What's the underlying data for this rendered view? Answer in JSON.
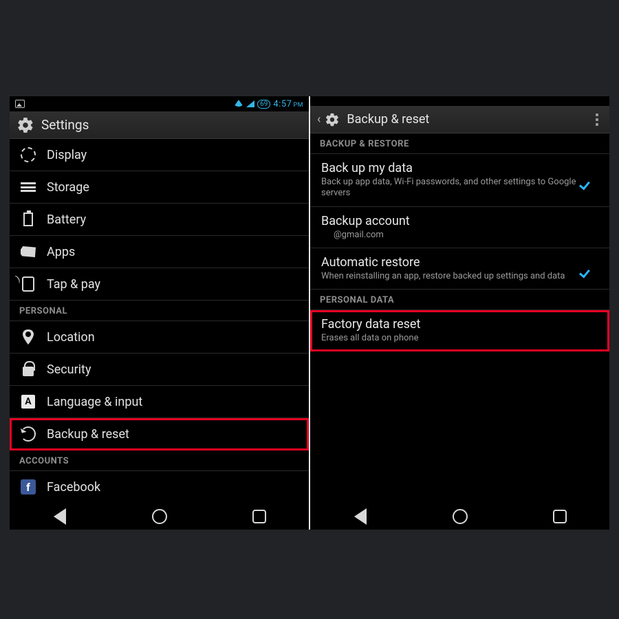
{
  "status": {
    "time": "4:57",
    "period": "PM",
    "battery": "69"
  },
  "left": {
    "title": "Settings",
    "items": [
      {
        "label": "Display",
        "icon": "display-icon"
      },
      {
        "label": "Storage",
        "icon": "storage-icon"
      },
      {
        "label": "Battery",
        "icon": "battery-icon"
      },
      {
        "label": "Apps",
        "icon": "apps-icon"
      },
      {
        "label": "Tap & pay",
        "icon": "tappay-icon"
      }
    ],
    "section_personal": "PERSONAL",
    "personal": [
      {
        "label": "Location",
        "icon": "location-icon"
      },
      {
        "label": "Security",
        "icon": "lock-icon"
      },
      {
        "label": "Language & input",
        "icon": "language-icon"
      },
      {
        "label": "Backup & reset",
        "icon": "reset-icon",
        "highlight": true
      }
    ],
    "section_accounts": "ACCOUNTS",
    "accounts": [
      {
        "label": "Facebook",
        "icon": "facebook-icon"
      }
    ]
  },
  "right": {
    "title": "Backup & reset",
    "section_backup": "BACKUP & RESTORE",
    "backup_items": [
      {
        "title": "Back up my data",
        "sub": "Back up app data, Wi-Fi passwords, and other settings to Google servers",
        "checked": true
      },
      {
        "title": "Backup account",
        "sub": "@gmail.com",
        "indent": true
      },
      {
        "title": "Automatic restore",
        "sub": "When reinstalling an app, restore backed up settings and data",
        "checked": true
      }
    ],
    "section_personal": "PERSONAL DATA",
    "personal_items": [
      {
        "title": "Factory data reset",
        "sub": "Erases all data on phone",
        "highlight": true
      }
    ]
  }
}
